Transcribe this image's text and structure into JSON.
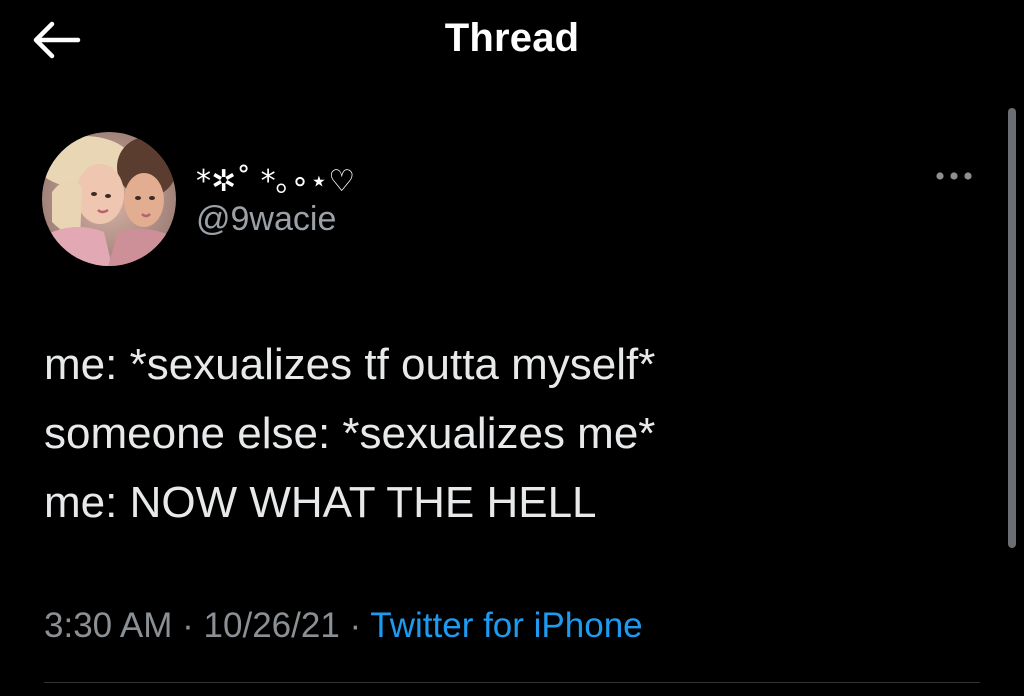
{
  "header": {
    "title": "Thread",
    "back_icon": "arrow-left-icon"
  },
  "tweet": {
    "display_name": "*✲˚ *｡∘⋆♡",
    "handle": "@9wacie",
    "more_icon": "more-horizontal-icon",
    "lines": [
      "me: *sexualizes tf outta myself*",
      "someone else: *sexualizes me*",
      "me: NOW WHAT THE HELL"
    ],
    "time": "3:30 AM",
    "date": "10/26/21",
    "separator": "·",
    "source": "Twitter for iPhone"
  },
  "colors": {
    "background": "#000000",
    "text_primary": "#e7e9ea",
    "text_secondary": "#8b9095",
    "accent": "#1d9bf0",
    "divider": "#2f3336"
  }
}
